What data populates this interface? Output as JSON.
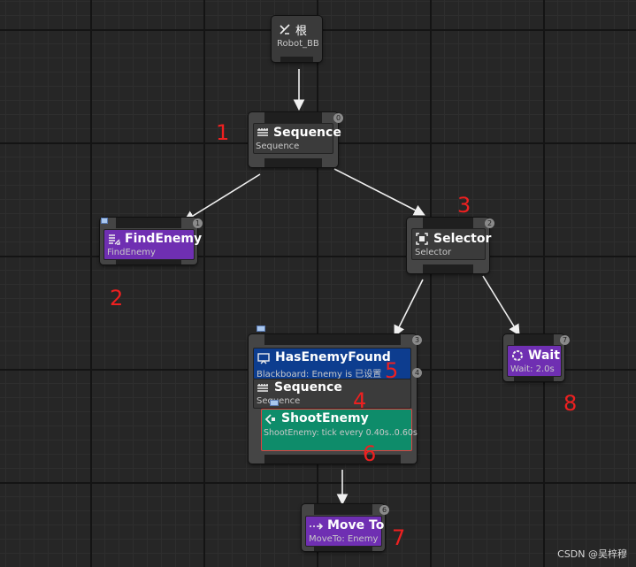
{
  "root": {
    "title": "根",
    "subtitle": "Robot_BB"
  },
  "nodes": {
    "sequence_main": {
      "title": "Sequence",
      "subtitle": "Sequence",
      "index": "0"
    },
    "find_enemy": {
      "title": "FindEnemy",
      "subtitle": "FindEnemy",
      "index": "1"
    },
    "selector": {
      "title": "Selector",
      "subtitle": "Selector",
      "index": "2"
    },
    "has_enemy_found": {
      "title": "HasEnemyFound",
      "subtitle": "Blackboard: Enemy is 已设置",
      "index": "3"
    },
    "sequence_inner": {
      "title": "Sequence",
      "subtitle": "Sequence",
      "index": "4"
    },
    "shoot_enemy": {
      "title": "ShootEnemy",
      "subtitle": "ShootEnemy: tick every 0.40s..0.60s",
      "index": "5"
    },
    "move_to": {
      "title": "Move To",
      "subtitle": "MoveTo: Enemy",
      "index": "6"
    },
    "wait": {
      "title": "Wait",
      "subtitle": "Wait: 2.0s",
      "index": "7"
    }
  },
  "annotations": [
    "1",
    "2",
    "3",
    "4",
    "5",
    "6",
    "7",
    "8"
  ],
  "watermark": "CSDN @吴梓穆",
  "colors": {
    "task_purple": "#6f2fb2",
    "decorator_blue": "#0d3d8f",
    "service_green": "#0e8c6a",
    "composite_gray": "#454545",
    "annotation_red": "#ee2020"
  }
}
